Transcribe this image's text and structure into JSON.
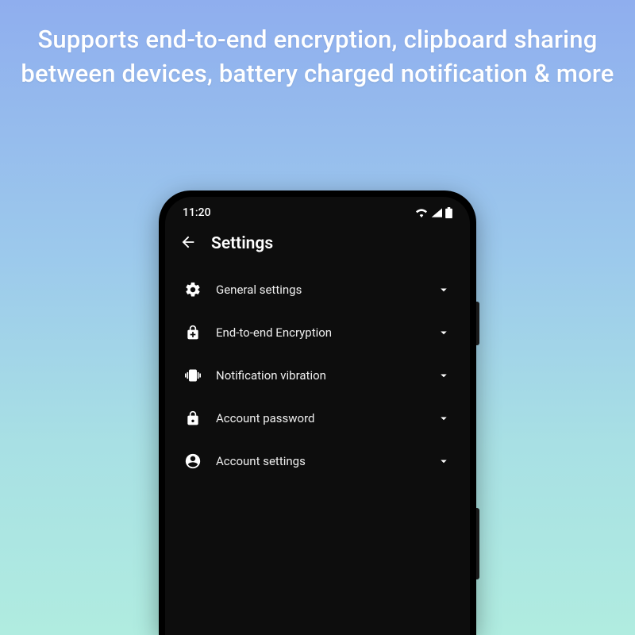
{
  "promo": {
    "headline": "Supports end-to-end encryption, clipboard sharing between devices, battery charged notification & more"
  },
  "statusbar": {
    "time": "11:20"
  },
  "appbar": {
    "title": "Settings"
  },
  "settings": {
    "items": [
      {
        "icon": "gear",
        "label": "General settings"
      },
      {
        "icon": "lock-plus",
        "label": "End-to-end Encryption"
      },
      {
        "icon": "vibrate",
        "label": "Notification vibration"
      },
      {
        "icon": "lock",
        "label": "Account password"
      },
      {
        "icon": "account",
        "label": "Account settings"
      }
    ]
  }
}
